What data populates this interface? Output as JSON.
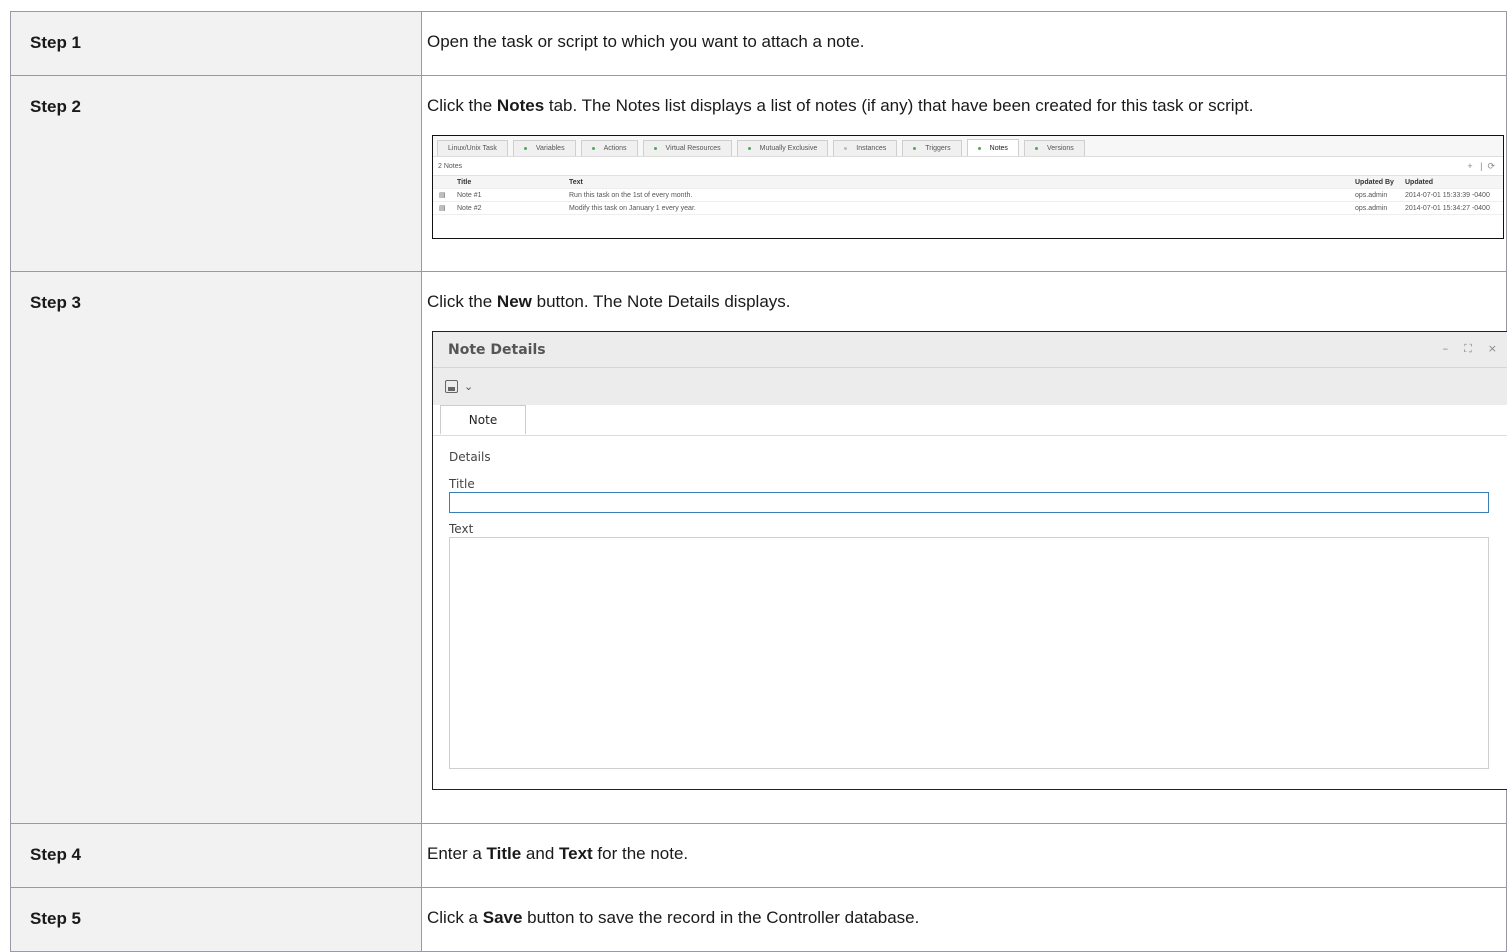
{
  "steps": [
    {
      "label": "Step 1",
      "text": [
        {
          "t": "Open the task or script to which you want to attach a note."
        }
      ]
    },
    {
      "label": "Step 2",
      "text": [
        {
          "t": "Click the "
        },
        {
          "t": "Notes",
          "b": true
        },
        {
          "t": " tab. The Notes list displays a list of notes (if any) that have been created for this task or script."
        }
      ]
    },
    {
      "label": "Step 3",
      "text": [
        {
          "t": "Click the "
        },
        {
          "t": "New",
          "b": true
        },
        {
          "t": " button. The Note Details displays."
        }
      ]
    },
    {
      "label": "Step 4",
      "text": [
        {
          "t": "Enter a "
        },
        {
          "t": "Title",
          "b": true
        },
        {
          "t": " and "
        },
        {
          "t": "Text",
          "b": true
        },
        {
          "t": " for the note."
        }
      ]
    },
    {
      "label": "Step 5",
      "text": [
        {
          "t": "Click a "
        },
        {
          "t": "Save",
          "b": true
        },
        {
          "t": " button to save the record in the Controller database."
        }
      ]
    }
  ],
  "notes_list": {
    "tabs": [
      {
        "label": "Linux/Unix Task",
        "dot": "none"
      },
      {
        "label": "Variables",
        "dot": "green"
      },
      {
        "label": "Actions",
        "dot": "green"
      },
      {
        "label": "Virtual Resources",
        "dot": "green"
      },
      {
        "label": "Mutually Exclusive",
        "dot": "green"
      },
      {
        "label": "Instances",
        "dot": "grey"
      },
      {
        "label": "Triggers",
        "dot": "green"
      },
      {
        "label": "Notes",
        "dot": "green",
        "active": true
      },
      {
        "label": "Versions",
        "dot": "green"
      }
    ],
    "count": "2 Notes",
    "add_icon": "+",
    "refresh_icon": "⟳",
    "columns": {
      "title": "Title",
      "text": "Text",
      "updated_by": "Updated By",
      "updated": "Updated"
    },
    "rows": [
      {
        "title": "Note #1",
        "text": "Run this task on the 1st of every month.",
        "updated_by": "ops.admin",
        "updated": "2014-07-01 15:33:39 -0400"
      },
      {
        "title": "Note #2",
        "text": "Modify this task on January 1 every year.",
        "updated_by": "ops.admin",
        "updated": "2014-07-01 15:34:27 -0400"
      }
    ]
  },
  "note_details": {
    "title": "Note Details",
    "minimize": "–",
    "maximize": "⛶",
    "close": "×",
    "dropdown": "⌄",
    "tab": "Note",
    "section": "Details",
    "title_label": "Title",
    "text_label": "Text"
  }
}
